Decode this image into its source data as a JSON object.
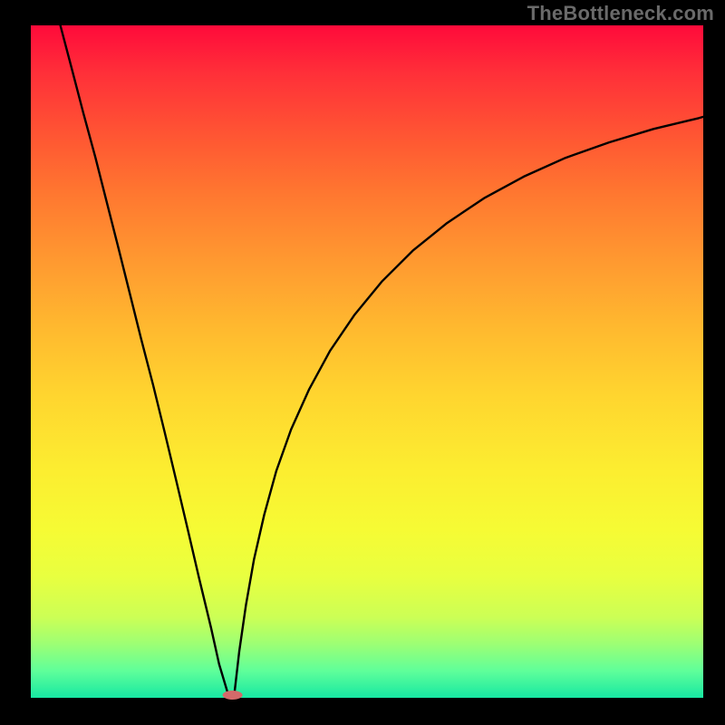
{
  "watermark": "TheBottleneck.com",
  "chart_data": {
    "type": "line",
    "title": "",
    "xlabel": "",
    "ylabel": "",
    "xlim": [
      0,
      1
    ],
    "ylim": [
      0,
      1
    ],
    "grid": false,
    "legend": false,
    "annotations": [],
    "series": [
      {
        "name": "left-branch",
        "x": [
          0.044,
          0.061,
          0.078,
          0.096,
          0.113,
          0.13,
          0.147,
          0.164,
          0.182,
          0.199,
          0.216,
          0.233,
          0.25,
          0.268,
          0.28,
          0.295
        ],
        "y": [
          1.0,
          0.935,
          0.87,
          0.804,
          0.737,
          0.67,
          0.602,
          0.534,
          0.465,
          0.395,
          0.324,
          0.252,
          0.179,
          0.104,
          0.05,
          0.0
        ]
      },
      {
        "name": "right-branch",
        "x": [
          0.302,
          0.31,
          0.32,
          0.332,
          0.347,
          0.365,
          0.387,
          0.414,
          0.445,
          0.481,
          0.522,
          0.568,
          0.619,
          0.674,
          0.733,
          0.795,
          0.86,
          0.926,
          0.993,
          1.0
        ],
        "y": [
          0.0,
          0.069,
          0.138,
          0.206,
          0.272,
          0.337,
          0.399,
          0.459,
          0.516,
          0.569,
          0.619,
          0.665,
          0.706,
          0.743,
          0.775,
          0.803,
          0.826,
          0.846,
          0.862,
          0.864
        ]
      }
    ],
    "marker": {
      "x": 0.3,
      "y": 0.0
    },
    "background_gradient": {
      "top": "#ff0a3a",
      "bottom": "#17e8a2"
    }
  }
}
